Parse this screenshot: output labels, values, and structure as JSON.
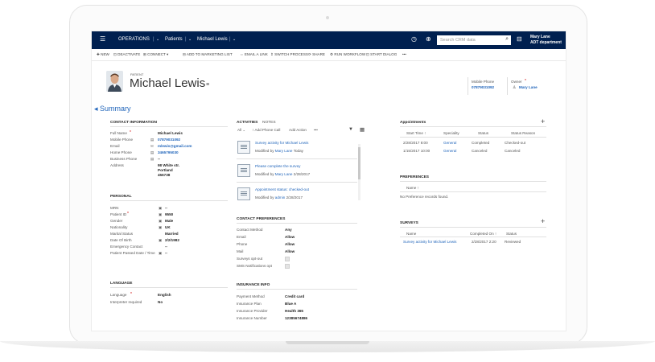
{
  "navbar": {
    "area": "OPERATIONS",
    "entity": "Patients",
    "record": "Michael Lewis",
    "search_placeholder": "Search CRM data",
    "user_name": "Mary Lane",
    "user_dept": "ADT department"
  },
  "commands": [
    "NEW",
    "DEACTIVATE",
    "CONNECT",
    "ADD TO MARKETING LIST",
    "EMAIL A LINK",
    "SWITCH PROCESS",
    "SHARE",
    "RUN WORKFLOW",
    "START DIALOG",
    "•••"
  ],
  "header": {
    "entity_label": "PATIENT",
    "name": "Michael Lewis",
    "mobile_label": "Mobile Phone",
    "mobile_value": "07879031092",
    "owner_label": "Owner",
    "owner_value": "Mary Lane"
  },
  "summary_title": "Summary",
  "contact": {
    "title": "CONTACT INFORMATION",
    "full_name_label": "Full Name",
    "full_name": "Michael Lewis",
    "mobile_label": "Mobile Phone",
    "mobile": "07879031092",
    "email_label": "Email",
    "email": "mlewis@gmail.com",
    "home_label": "Home Phone",
    "home": "3465795030",
    "business_label": "Business Phone",
    "business": "--",
    "address_label": "Address",
    "address_1": "98 White str.",
    "address_2": "Portland",
    "address_3": "456738"
  },
  "personal": {
    "title": "PERSONAL",
    "rows": [
      {
        "label": "MRN",
        "value": "--"
      },
      {
        "label": "Patient ID",
        "value": "9550"
      },
      {
        "label": "Gender",
        "value": "Male"
      },
      {
        "label": "Nationality",
        "value": "UK"
      },
      {
        "label": "Marital Status",
        "value": "Married"
      },
      {
        "label": "Date Of Birth",
        "value": "2/2/1982"
      },
      {
        "label": "Emergency Contact",
        "value": "--"
      },
      {
        "label": "Patient Passed Date / Time",
        "value": "--"
      }
    ]
  },
  "language": {
    "title": "LANGUAGE",
    "lang_label": "Language",
    "lang_value": "English",
    "interp_label": "Interpreter required",
    "interp_value": "No"
  },
  "activities": {
    "tab_activities": "ACTIVITIES",
    "tab_notes": "NOTES",
    "filter": "All",
    "add_phone": "Add Phone Call",
    "add_action": "Add Action",
    "more": "•••",
    "items": [
      {
        "title": "Survey activity for Michael Lewis",
        "meta_prefix": "Modified by",
        "author": "Mary Lane",
        "date": "Today"
      },
      {
        "title": "Please complete the survey",
        "meta_prefix": "Modified by",
        "author": "Mary Lane",
        "date": "2/28/2017"
      },
      {
        "title": "Appointment status: checked-out",
        "meta_prefix": "Modified by",
        "author": "admin",
        "date": "2/28/2017"
      }
    ]
  },
  "contact_prefs": {
    "title": "CONTACT PREFERENCES",
    "rows": [
      {
        "label": "Contact Method",
        "value": "Any"
      },
      {
        "label": "Email",
        "value": "Allow"
      },
      {
        "label": "Phone",
        "value": "Allow"
      },
      {
        "label": "Mail",
        "value": "Allow"
      }
    ],
    "surveys_label": "Surveys opt-out",
    "sms_label": "SMS Notifications opt"
  },
  "insurance": {
    "title": "INSURANCE INFO",
    "rows": [
      {
        "label": "Payment Method",
        "value": "Credit card"
      },
      {
        "label": "Insurance Plan",
        "value": "Blue A"
      },
      {
        "label": "Insurance Provider",
        "value": "Health 365"
      },
      {
        "label": "Insurance Number",
        "value": "12385674886"
      }
    ]
  },
  "appointments": {
    "title": "Appointments",
    "headers": [
      "Start Time ↑",
      "Speciality",
      "Status",
      "Status Reason"
    ],
    "rows": [
      [
        "2/28/2017 8:00",
        "General",
        "Completed",
        "Checked-out"
      ],
      [
        "1/15/2017 10:00",
        "General",
        "Canceled",
        "Canceled"
      ]
    ]
  },
  "preferences": {
    "title": "PREFERENCES",
    "header": "Name ↑",
    "empty": "No Preference records found."
  },
  "surveys": {
    "title": "SURVEYS",
    "headers": [
      "Name",
      "Completed On ↑",
      "Status"
    ],
    "row": [
      "Survey activity for Michael Lewis",
      "2/28/2017 2:20",
      "Reviewed"
    ]
  }
}
